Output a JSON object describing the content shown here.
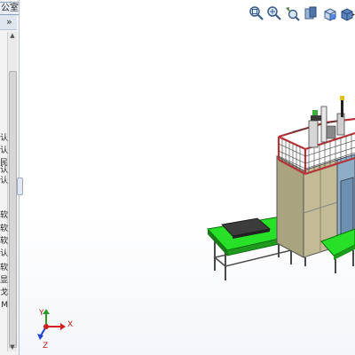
{
  "panel": {
    "title_tab": "公室产品",
    "expand_glyph": "»",
    "tree_glyphs": [
      "认",
      "认",
      "民",
      "认",
      "认",
      "软",
      "软",
      "软",
      "认",
      "软",
      "显",
      "戈",
      "M"
    ]
  },
  "view_toolbar": {
    "buttons": [
      "zoom-to-fit",
      "zoom-to-area",
      "previous-view",
      "section-view",
      "view-orientation",
      "display-style"
    ]
  },
  "triad": {
    "x_label": "X",
    "y_label": "Y",
    "z_label": "Z"
  },
  "colors": {
    "frame_red": "#b7333a",
    "conveyor_green": "#22e022",
    "cabinet_olive": "#a8a27e",
    "cabinet_blue": "#8eaec8",
    "frame_gray": "#5a5a5a"
  }
}
